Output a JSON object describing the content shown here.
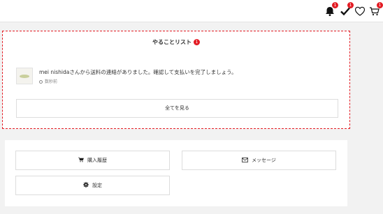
{
  "header": {
    "icons": [
      {
        "name": "bell-icon",
        "badge": "1"
      },
      {
        "name": "checkmark-icon",
        "badge": "1"
      },
      {
        "name": "heart-icon"
      },
      {
        "name": "cart-icon",
        "badge": "1"
      }
    ]
  },
  "todo": {
    "title": "やることリスト",
    "badge": "1",
    "message": "mei nishidaさんから送料の連絡がありました。確認して支払いを完了しましょう。",
    "time": "数秒前",
    "view_all": "全てを見る"
  },
  "menu": {
    "purchase_history": "購入履歴",
    "messages": "メッセージ",
    "settings": "設定"
  },
  "colors": {
    "accent": "#e31b23",
    "background": "#f2f2f2"
  }
}
